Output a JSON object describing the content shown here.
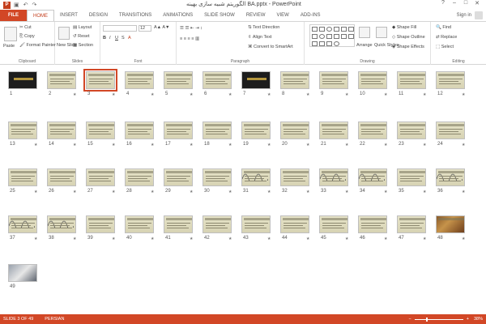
{
  "window": {
    "app_icon": "powerpoint-icon",
    "title": "BA.pptx - PowerPoint",
    "title_rtl": "الگوریتم شبیه سازی بهینه",
    "controls": [
      "?",
      "–",
      "□",
      "✕"
    ]
  },
  "quick_access": {
    "save_icon": "save-icon",
    "undo_icon": "undo-icon",
    "redo_icon": "redo-icon"
  },
  "tabs": [
    "FILE",
    "HOME",
    "INSERT",
    "DESIGN",
    "TRANSITIONS",
    "ANIMATIONS",
    "SLIDE SHOW",
    "REVIEW",
    "VIEW",
    "ADD-INS"
  ],
  "active_tab": "HOME",
  "signin": "Sign in",
  "ribbon": {
    "clipboard": {
      "label": "Clipboard",
      "paste": "Paste",
      "cut": "Cut",
      "copy": "Copy",
      "format_painter": "Format Painter"
    },
    "slides": {
      "label": "Slides",
      "new_slide": "New Slide",
      "layout": "Layout",
      "reset": "Reset",
      "section": "Section"
    },
    "font": {
      "label": "Font",
      "size": "12"
    },
    "paragraph": {
      "label": "Paragraph",
      "text_direction": "Text Direction",
      "align_text": "Align Text",
      "convert_smartart": "Convert to SmartArt"
    },
    "drawing": {
      "label": "Drawing",
      "arrange": "Arrange",
      "quick_styles": "Quick Styles",
      "shape_fill": "Shape Fill",
      "shape_outline": "Shape Outline",
      "shape_effects": "Shape Effects"
    },
    "editing": {
      "label": "Editing",
      "find": "Find",
      "replace": "Replace",
      "select": "Select"
    }
  },
  "slides": [
    {
      "n": "1",
      "t": "dark"
    },
    {
      "n": "2",
      "t": "std"
    },
    {
      "n": "3",
      "t": "sel"
    },
    {
      "n": "4",
      "t": "std"
    },
    {
      "n": "5",
      "t": "std"
    },
    {
      "n": "6",
      "t": "std"
    },
    {
      "n": "7",
      "t": "dark"
    },
    {
      "n": "8",
      "t": "std"
    },
    {
      "n": "9",
      "t": "std"
    },
    {
      "n": "10",
      "t": "std"
    },
    {
      "n": "11",
      "t": "std"
    },
    {
      "n": "12",
      "t": "std"
    },
    {
      "n": "13",
      "t": "std"
    },
    {
      "n": "14",
      "t": "std"
    },
    {
      "n": "15",
      "t": "std"
    },
    {
      "n": "16",
      "t": "std"
    },
    {
      "n": "17",
      "t": "std"
    },
    {
      "n": "18",
      "t": "std"
    },
    {
      "n": "19",
      "t": "std"
    },
    {
      "n": "20",
      "t": "std"
    },
    {
      "n": "21",
      "t": "std"
    },
    {
      "n": "22",
      "t": "std"
    },
    {
      "n": "23",
      "t": "std"
    },
    {
      "n": "24",
      "t": "std"
    },
    {
      "n": "25",
      "t": "std"
    },
    {
      "n": "26",
      "t": "std"
    },
    {
      "n": "27",
      "t": "std"
    },
    {
      "n": "28",
      "t": "std"
    },
    {
      "n": "29",
      "t": "std"
    },
    {
      "n": "30",
      "t": "std"
    },
    {
      "n": "31",
      "t": "wave"
    },
    {
      "n": "32",
      "t": "std"
    },
    {
      "n": "33",
      "t": "wave"
    },
    {
      "n": "34",
      "t": "wave"
    },
    {
      "n": "35",
      "t": "std"
    },
    {
      "n": "36",
      "t": "wave"
    },
    {
      "n": "37",
      "t": "wave"
    },
    {
      "n": "38",
      "t": "wave"
    },
    {
      "n": "39",
      "t": "std"
    },
    {
      "n": "40",
      "t": "std"
    },
    {
      "n": "41",
      "t": "std"
    },
    {
      "n": "42",
      "t": "std"
    },
    {
      "n": "43",
      "t": "std"
    },
    {
      "n": "44",
      "t": "std"
    },
    {
      "n": "45",
      "t": "std"
    },
    {
      "n": "46",
      "t": "std"
    },
    {
      "n": "47",
      "t": "std"
    },
    {
      "n": "48",
      "t": "photo"
    },
    {
      "n": "49",
      "t": "photo2"
    }
  ],
  "statusbar": {
    "slide_info": "SLIDE 3 OF 49",
    "language": "PERSIAN",
    "zoom": "38%"
  },
  "colors": {
    "accent": "#d24726",
    "slide_bg": "#e3e0c4",
    "dark_slide": "#1d1d1d"
  }
}
